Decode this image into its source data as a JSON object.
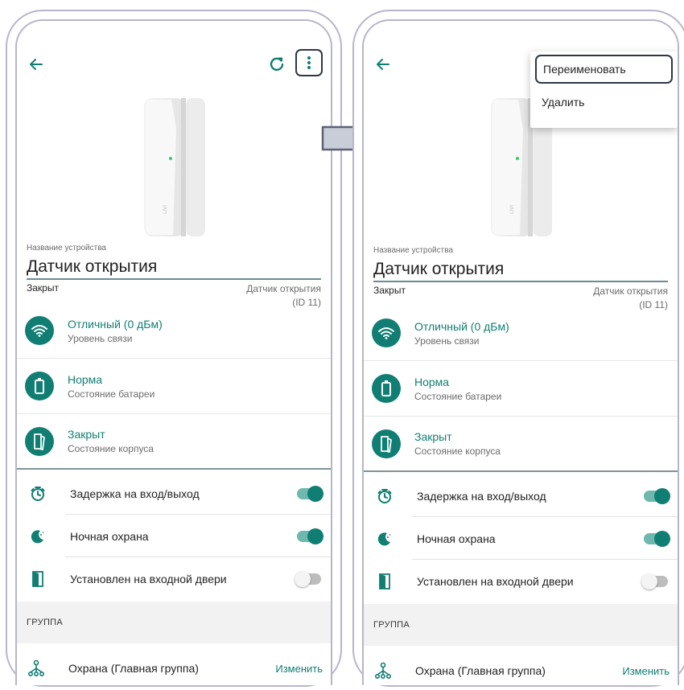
{
  "screen": {
    "name_label": "Название устройства",
    "name_value": "Датчик открытия",
    "status_left": "Закрыт",
    "status_right_1": "Датчик открытия",
    "status_right_2": "(ID 11)",
    "info": [
      {
        "title": "Отличный (0 дБм)",
        "subtitle": "Уровень связи",
        "icon": "wifi-icon"
      },
      {
        "title": "Норма",
        "subtitle": "Состояние батареи",
        "icon": "battery-icon"
      },
      {
        "title": "Закрыт",
        "subtitle": "Состояние корпуса",
        "icon": "case-icon"
      }
    ],
    "toggles": [
      {
        "label": "Задержка на вход/выход",
        "state": "on",
        "icon": "timer-icon"
      },
      {
        "label": "Ночная охрана",
        "state": "on",
        "icon": "moon-icon"
      },
      {
        "label": "Установлен на входной двери",
        "state": "off",
        "icon": "door-icon"
      }
    ],
    "group_header": "ГРУППА",
    "group_name": "Охрана (Главная группа)",
    "group_action": "Изменить"
  },
  "menu": {
    "rename": "Переименовать",
    "delete": "Удалить"
  },
  "colors": {
    "accent": "#107e73",
    "frame": "#b7b5cc",
    "highlight_border": "#2d3748"
  }
}
